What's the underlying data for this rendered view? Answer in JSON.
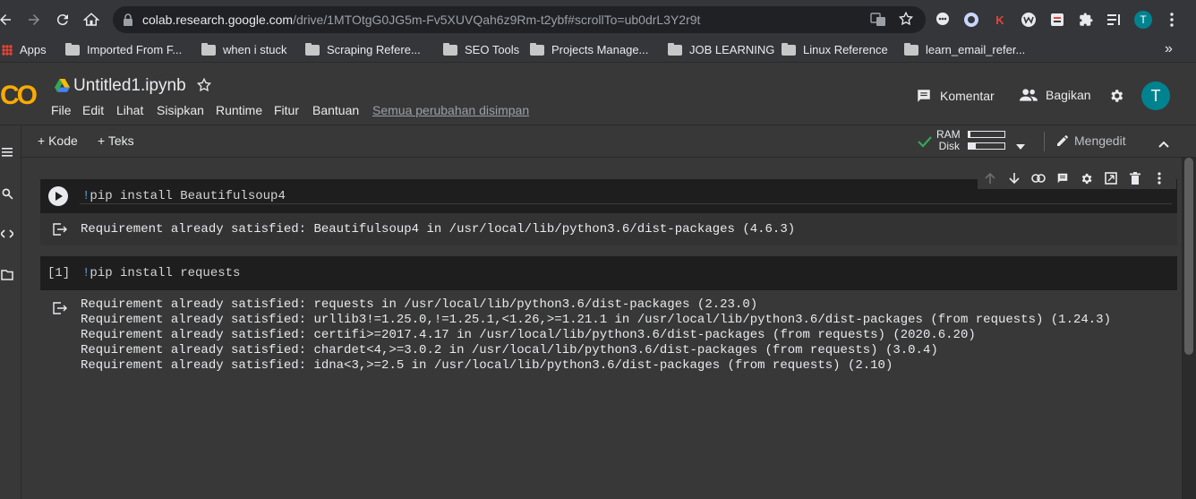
{
  "browser": {
    "url_host": "colab.research.google.com",
    "url_path": "/drive/1MTOtgG0JG5m-Fv5XUVQah6z9Rm-t2ybf#scrollTo=ub0drL3Y2r9t",
    "profile_initial": "T",
    "ext_k": "K"
  },
  "bookmarks": [
    {
      "label": "Apps"
    },
    {
      "label": "Imported From F..."
    },
    {
      "label": "when i stuck"
    },
    {
      "label": "Scraping Refere..."
    },
    {
      "label": "SEO Tools"
    },
    {
      "label": "Projects Manage..."
    },
    {
      "label": "JOB LEARNING"
    },
    {
      "label": "Linux Reference"
    },
    {
      "label": "learn_email_refer..."
    }
  ],
  "header": {
    "logo": "CO",
    "title": "Untitled1.ipynb",
    "menu": [
      "File",
      "Edit",
      "Lihat",
      "Sisipkan",
      "Runtime",
      "Fitur",
      "Bantuan"
    ],
    "saved_status": "Semua perubahan disimpan",
    "comment_label": "Komentar",
    "share_label": "Bagikan",
    "avatar_initial": "T"
  },
  "toolbar": {
    "add_code": "Kode",
    "add_text": "Teks",
    "ram_label": "RAM",
    "disk_label": "Disk",
    "ram_usage": 0.05,
    "disk_usage": 0.2,
    "editing_label": "Mengedit"
  },
  "cells": [
    {
      "exec_count": "",
      "code_bang": "!",
      "code_rest": "pip install Beautifulsoup4",
      "output": "Requirement already satisfied: Beautifulsoup4 in /usr/local/lib/python3.6/dist-packages (4.6.3)"
    },
    {
      "exec_count": "[1]",
      "code_bang": "!",
      "code_rest": "pip install requests",
      "output": "Requirement already satisfied: requests in /usr/local/lib/python3.6/dist-packages (2.23.0)\nRequirement already satisfied: urllib3!=1.25.0,!=1.25.1,<1.26,>=1.21.1 in /usr/local/lib/python3.6/dist-packages (from requests) (1.24.3)\nRequirement already satisfied: certifi>=2017.4.17 in /usr/local/lib/python3.6/dist-packages (from requests) (2020.6.20)\nRequirement already satisfied: chardet<4,>=3.0.2 in /usr/local/lib/python3.6/dist-packages (from requests) (3.0.4)\nRequirement already satisfied: idna<3,>=2.5 in /usr/local/lib/python3.6/dist-packages (from requests) (2.10)"
    }
  ],
  "colors": {
    "accent": "#f9ab00",
    "avatar": "#00838f",
    "check": "#34a853"
  }
}
